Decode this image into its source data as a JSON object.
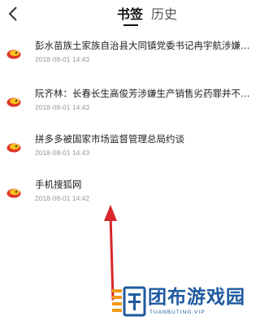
{
  "header": {
    "back_icon": "chevron-left-icon",
    "tabs": [
      {
        "label": "书签",
        "active": true
      },
      {
        "label": "历史",
        "active": false
      }
    ]
  },
  "bookmarks": [
    {
      "title": "彭水苗族土家族自治县大同镇党委书记冉宇航涉嫌严…",
      "time": "2018-08-01 14:43",
      "icon": "sohu-fox-icon"
    },
    {
      "title": "阮齐林：长春长生高俊芳涉嫌生产销售劣药罪并不是…",
      "time": "2018-08-01 14:43",
      "icon": "sohu-fox-icon"
    },
    {
      "title": "拼多多被国家市场监督管理总局约谈",
      "time": "2018-08-01 14:43",
      "icon": "sohu-fox-icon"
    },
    {
      "title": "手机搜狐网",
      "time": "2018-08-01 14:42",
      "icon": "sohu-fox-icon"
    }
  ],
  "watermark": {
    "text": "团布游戏园",
    "url": "TUANBUTING.VIP"
  },
  "colors": {
    "arrow": "#d8262a",
    "watermark_blue": "#1e5aa0",
    "watermark_orange": "#f29a1b",
    "icon_red": "#e0352b",
    "icon_yellow": "#f7c21a"
  }
}
